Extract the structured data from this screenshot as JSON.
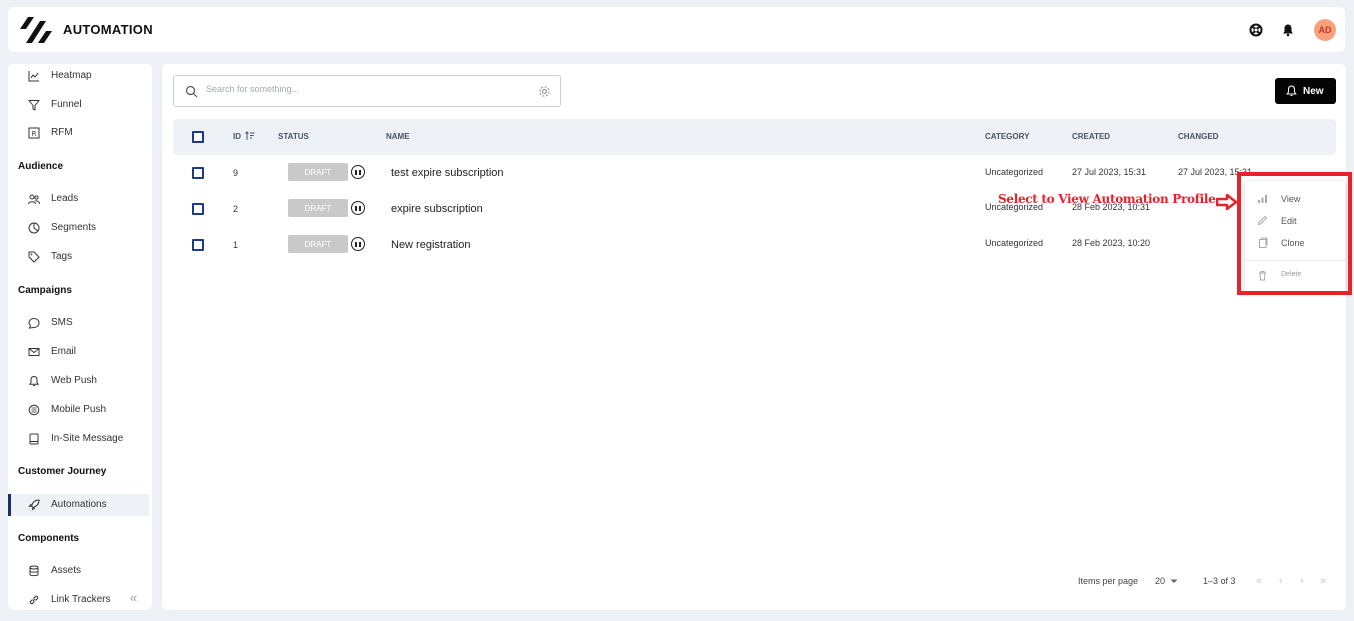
{
  "header": {
    "app_title": "AUTOMATION",
    "avatar_initials": "AD",
    "avatar_color": "#f7a07c"
  },
  "sidebar": {
    "items_top": [
      {
        "label": "Heatmap",
        "icon": "chart-icon"
      },
      {
        "label": "Funnel",
        "icon": "funnel-icon"
      },
      {
        "label": "RFM",
        "icon": "rfm-icon"
      }
    ],
    "sections": [
      {
        "title": "Audience",
        "items": [
          {
            "label": "Leads",
            "icon": "users-icon"
          },
          {
            "label": "Segments",
            "icon": "pie-icon"
          },
          {
            "label": "Tags",
            "icon": "tag-icon"
          }
        ]
      },
      {
        "title": "Campaigns",
        "items": [
          {
            "label": "SMS",
            "icon": "chat-icon"
          },
          {
            "label": "Email",
            "icon": "mail-icon"
          },
          {
            "label": "Web Push",
            "icon": "bell-icon"
          },
          {
            "label": "Mobile Push",
            "icon": "mobile-icon"
          },
          {
            "label": "In-Site Message",
            "icon": "message-icon"
          }
        ]
      },
      {
        "title": "Customer Journey",
        "items": [
          {
            "label": "Automations",
            "icon": "rocket-icon",
            "active": true
          }
        ]
      },
      {
        "title": "Components",
        "items": [
          {
            "label": "Assets",
            "icon": "database-icon"
          },
          {
            "label": "Link Trackers",
            "icon": "link-icon"
          }
        ]
      }
    ],
    "collapse_glyph": "«"
  },
  "toolbar": {
    "search_placeholder": "Search for something...",
    "new_label": "New"
  },
  "table": {
    "columns": {
      "id": "ID",
      "status": "STATUS",
      "name": "NAME",
      "category": "CATEGORY",
      "created": "CREATED",
      "changed": "CHANGED"
    },
    "rows": [
      {
        "id": "9",
        "status": "DRAFT",
        "name": "test expire subscription",
        "category": "Uncategorized",
        "created": "27 Jul 2023, 15:31",
        "changed": "27 Jul 2023, 15:31"
      },
      {
        "id": "2",
        "status": "DRAFT",
        "name": "expire subscription",
        "category": "Uncategorized",
        "created": "28 Feb 2023, 10:31",
        "changed": ""
      },
      {
        "id": "1",
        "status": "DRAFT",
        "name": "New registration",
        "category": "Uncategorized",
        "created": "28 Feb 2023, 10:20",
        "changed": ""
      }
    ]
  },
  "context_menu": {
    "items": [
      {
        "label": "View",
        "icon": "bar-chart-icon"
      },
      {
        "label": "Edit",
        "icon": "pencil-icon"
      },
      {
        "label": "Clone",
        "icon": "copy-icon"
      },
      {
        "label": "Delete",
        "icon": "trash-icon"
      }
    ]
  },
  "annotation": {
    "text": "Select to View Automation Profile",
    "color": "#e8222a"
  },
  "pagination": {
    "items_per_page_label": "Items per page",
    "items_per_page": "20",
    "range": "1–3 of 3"
  }
}
